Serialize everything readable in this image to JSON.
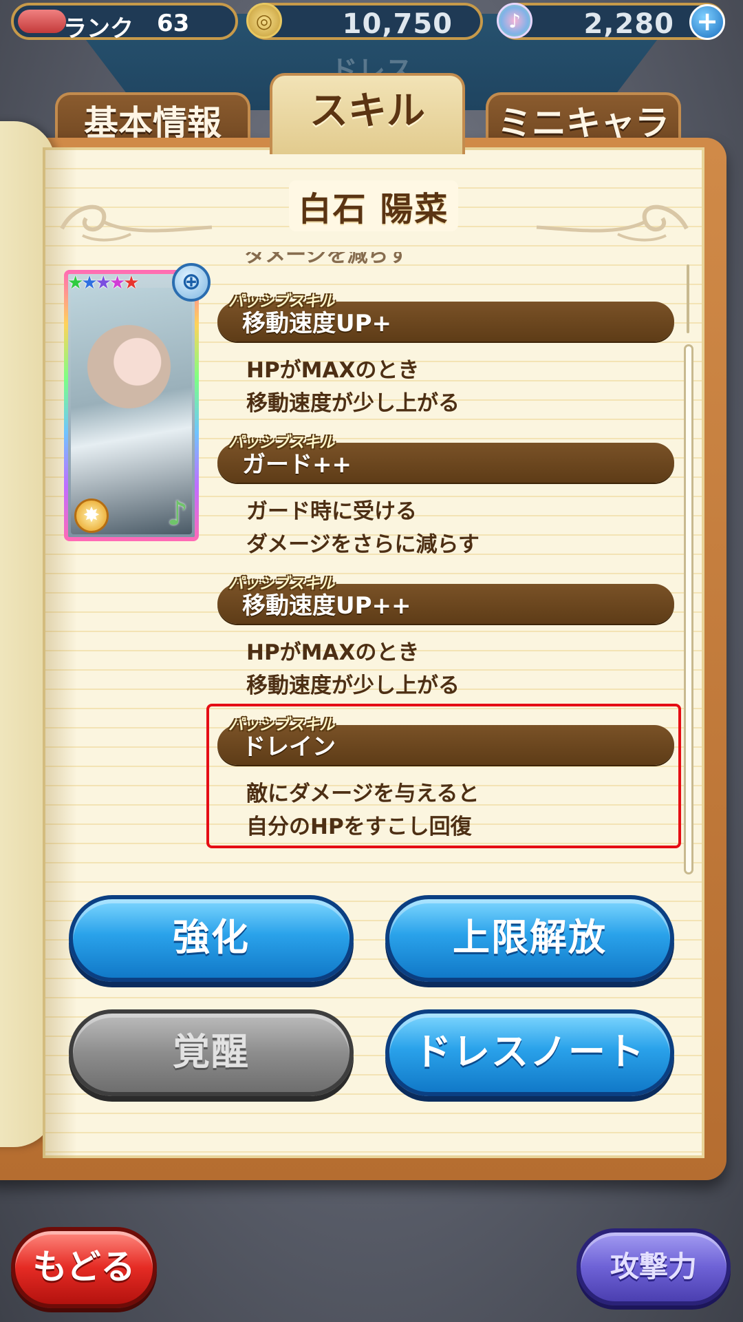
{
  "status": {
    "rank_label": "ランク",
    "rank_value": "63",
    "coin_icon": "coin-icon",
    "coins": "10,750",
    "note_icon": "music-note-icon",
    "gems": "2,280",
    "plus_symbol": "+"
  },
  "header": {
    "title": "ドレス"
  },
  "tabs": [
    {
      "label": "基本情報",
      "active": false
    },
    {
      "label": "スキル",
      "active": true
    },
    {
      "label": "ミニキャラ",
      "active": false
    }
  ],
  "character": {
    "name": "白石 陽菜",
    "stars": [
      "#2ecc40",
      "#2f6fe0",
      "#7b4fe0",
      "#d13bd6",
      "#e8342e"
    ],
    "zoom_symbol": "⊕"
  },
  "skills": {
    "cut_text": "ダメージを減らす",
    "items": [
      {
        "type": "パッシブスキル",
        "name": "移動速度UP+",
        "desc1": "HPがMAXのとき",
        "desc2": "移動速度が少し上がる"
      },
      {
        "type": "パッシブスキル",
        "name": "ガード++",
        "desc1": "ガード時に受ける",
        "desc2": "ダメージをさらに減らす"
      },
      {
        "type": "パッシブスキル",
        "name": "移動速度UP++",
        "desc1": "HPがMAXのとき",
        "desc2": "移動速度が少し上がる"
      },
      {
        "type": "パッシブスキル",
        "name": "ドレイン",
        "desc1": "敵にダメージを与えると",
        "desc2": "自分のHPをすこし回復"
      }
    ]
  },
  "buttons": {
    "enhance": "強化",
    "limit_break": "上限解放",
    "awaken": "覚醒",
    "dress_note": "ドレスノート",
    "back": "もどる",
    "attack": "攻撃力"
  },
  "colors": {
    "highlight": "#e50d14",
    "skill_bar": "#6b4520",
    "button_blue": "#1f8fdb",
    "button_gray": "#8d8d8d"
  }
}
